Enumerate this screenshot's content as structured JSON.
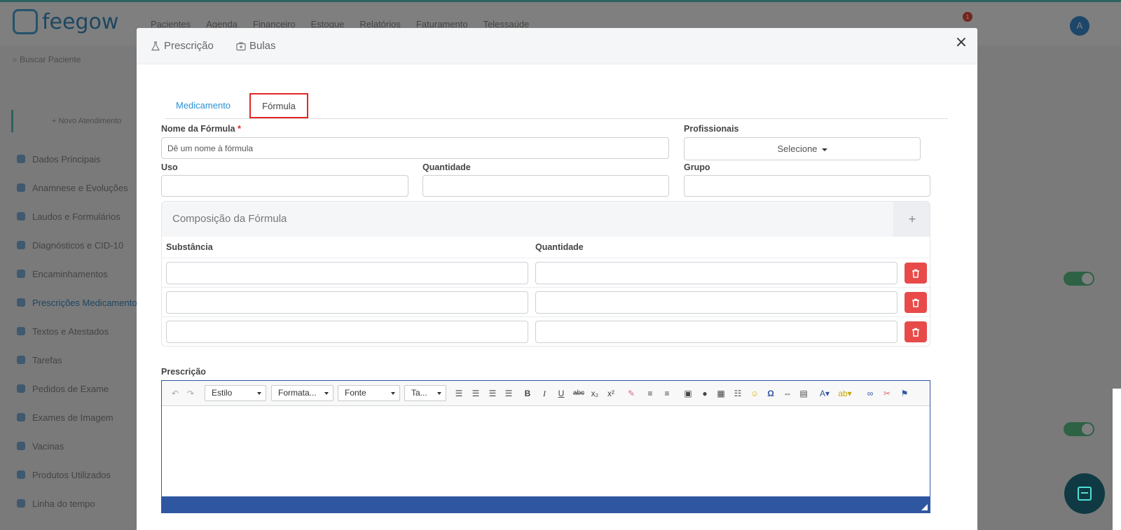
{
  "app": {
    "logo": "feegow",
    "nav": [
      "Pacientes",
      "Agenda",
      "Financeiro",
      "Estoque",
      "Relatórios",
      "Faturamento",
      "Telessaúde"
    ],
    "notif_count": "1",
    "avatar_initial": "A",
    "search_placeholder": "Buscar Paciente",
    "new_item": "+ Novo Atendimento",
    "sidebar": [
      "Dados Principais",
      "Anamnese e Evoluções",
      "Laudos e Formulários",
      "Diagnósticos e CID-10",
      "Encaminhamentos",
      "Prescrições Medicamentos",
      "Textos e Atestados",
      "Tarefas",
      "Pedidos de Exame",
      "Exames de Imagem",
      "Vacinas",
      "Produtos Utilizados",
      "Linha do tempo"
    ]
  },
  "modal": {
    "tabs": [
      "Prescrição",
      "Bulas"
    ],
    "close": "×",
    "subtabs": {
      "medicamento": "Medicamento",
      "formula": "Fórmula"
    },
    "fields": {
      "nome_label": "Nome da Fórmula",
      "required_mark": "*",
      "nome_placeholder": "Dê um nome à fórmula",
      "profissionais_label": "Profissionais",
      "profissionais_value": "Selecione",
      "uso_label": "Uso",
      "quantidade_label": "Quantidade",
      "grupo_label": "Grupo"
    },
    "composicao": {
      "title": "Composição da Fórmula",
      "add": "+",
      "col_substancia": "Substância",
      "col_quantidade": "Quantidade",
      "rows": [
        {
          "substancia": "",
          "quantidade": ""
        },
        {
          "substancia": "",
          "quantidade": ""
        },
        {
          "substancia": "",
          "quantidade": ""
        }
      ]
    },
    "prescricao": {
      "label": "Prescrição",
      "toolbar": {
        "estilo": "Estilo",
        "formatacao": "Formata...",
        "fonte": "Fonte",
        "tamanho": "Ta...",
        "bold": "B",
        "italic": "I",
        "underline": "U",
        "strike": "abc",
        "subscript": "x₂",
        "superscript": "x²",
        "special_char": "Ω"
      },
      "content": ""
    }
  },
  "colors": {
    "accent": "#2d8fd5",
    "danger": "#e84a4a",
    "highlight": "#e02828",
    "editor_border": "#3257a0"
  }
}
